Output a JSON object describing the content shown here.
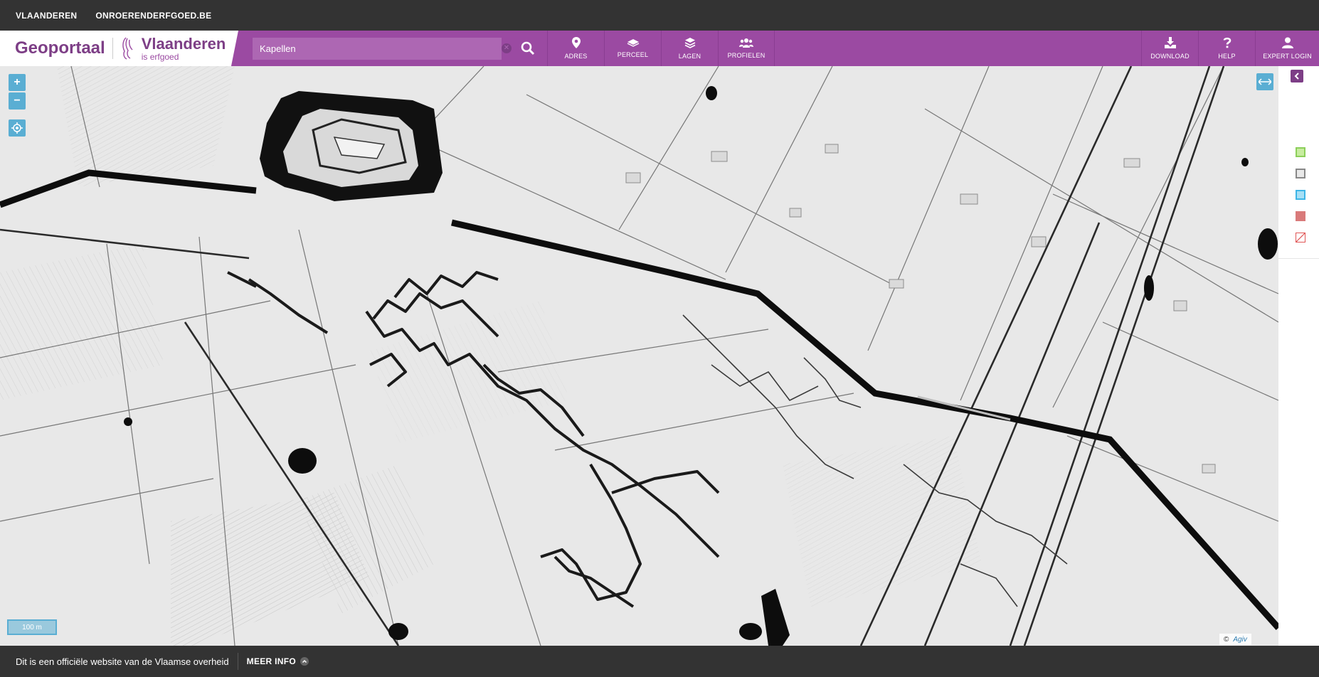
{
  "topbar": {
    "links": [
      "VLAANDEREN",
      "ONROERENDERFGOED.BE"
    ]
  },
  "brand": {
    "title": "Geoportaal",
    "name": "Vlaanderen",
    "subtitle": "is erfgoed"
  },
  "search": {
    "value": "Kapellen"
  },
  "nav_left": [
    {
      "label": "ADRES",
      "icon": "map-pin-icon"
    },
    {
      "label": "PERCEEL",
      "icon": "parcel-icon"
    },
    {
      "label": "LAGEN",
      "icon": "layers-icon"
    },
    {
      "label": "PROFIELEN",
      "icon": "users-icon"
    }
  ],
  "nav_right": [
    {
      "label": "DOWNLOAD",
      "icon": "download-icon"
    },
    {
      "label": "HELP",
      "icon": "help-icon"
    },
    {
      "label": "EXPERT LOGIN",
      "icon": "user-icon"
    }
  ],
  "map": {
    "zoom_in": "+",
    "zoom_out": "−",
    "scale_label": "100 m",
    "attribution": "©",
    "attribution_logo": "Agiv"
  },
  "legend_colors": [
    "#8ccf5a",
    "#888888",
    "#3db5e6",
    "#d97a7a",
    "#e05555"
  ],
  "footer": {
    "text": "Dit is een officiële website van de Vlaamse overheid",
    "more": "MEER INFO"
  },
  "colors": {
    "brand": "#9b4aa2",
    "dark": "#333333",
    "accent": "#5aaed3"
  }
}
